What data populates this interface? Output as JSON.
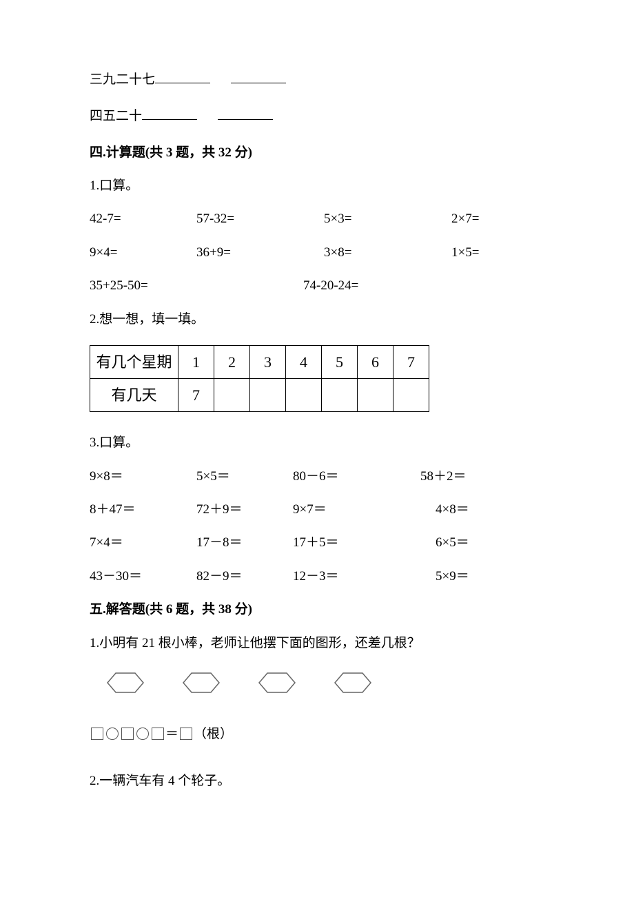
{
  "fill": {
    "line1": "三九二十七",
    "line2": "四五二十"
  },
  "section4": {
    "header": "四.计算题(共 3 题，共 32 分)",
    "q1": {
      "title": "1.口算。",
      "rows": [
        [
          "42-7=",
          "57-32=",
          "5×3=",
          "2×7="
        ],
        [
          "9×4=",
          "36+9=",
          "3×8=",
          "1×5="
        ],
        [
          "35+25-50=",
          "",
          "74-20-24=",
          ""
        ]
      ]
    },
    "q2": {
      "title": "2.想一想，填一填。",
      "table": {
        "row1_label": "有几个星期",
        "row1_values": [
          "1",
          "2",
          "3",
          "4",
          "5",
          "6",
          "7"
        ],
        "row2_label": "有几天",
        "row2_values": [
          "7",
          "",
          "",
          "",
          "",
          "",
          ""
        ]
      }
    },
    "q3": {
      "title": "3.口算。",
      "rows": [
        [
          "9×8＝",
          "5×5＝",
          "80－6＝",
          "58＋2＝"
        ],
        [
          "8＋47＝",
          "72＋9＝",
          "9×7＝",
          "4×8＝"
        ],
        [
          "7×4＝",
          "17－8＝",
          "17＋5＝",
          "6×5＝"
        ],
        [
          "43－30＝",
          "82－9＝",
          "12－3＝",
          "5×9＝"
        ]
      ]
    }
  },
  "section5": {
    "header": "五.解答题(共 6 题，共 38 分)",
    "q1": {
      "title": "1.小明有 21 根小棒，老师让他摆下面的图形，还差几根？",
      "hex_count": 4,
      "formula_tail": "（根）"
    },
    "q2": {
      "title": "2.一辆汽车有 4 个轮子。"
    }
  }
}
